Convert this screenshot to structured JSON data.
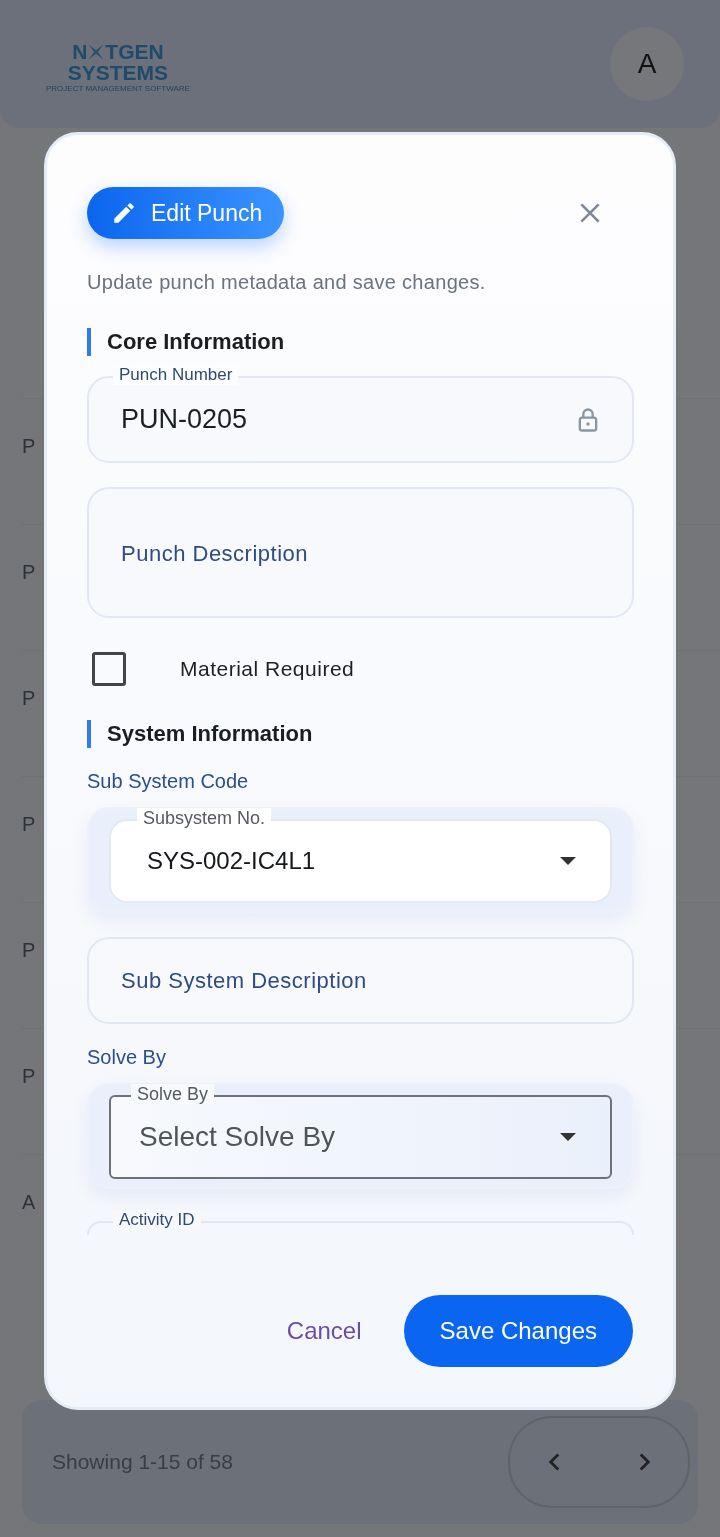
{
  "background": {
    "logo": {
      "lead": "N",
      "rest": "TGEN",
      "second": "SYSTEMS",
      "tagline": "PROJECT MANAGEMENT SOFTWARE"
    },
    "avatar": "A",
    "rows": [
      {
        "code": "P"
      },
      {
        "code": "P"
      },
      {
        "code": "P"
      },
      {
        "code": "P"
      },
      {
        "code": "P"
      },
      {
        "code": "P"
      },
      {
        "code": "A"
      }
    ],
    "footer": {
      "showing": "Showing 1-15 of 58"
    }
  },
  "dialog": {
    "badge": "Edit Punch",
    "subtitle": "Update punch metadata and save changes.",
    "sections": [
      {
        "title": "Core Information",
        "fields": [
          {
            "kind": "locked",
            "label": "Punch Number",
            "value": "PUN-0205"
          },
          {
            "kind": "textarea",
            "placeholder": "Punch Description"
          },
          {
            "kind": "checkbox",
            "label": "Material Required",
            "checked": false
          }
        ]
      },
      {
        "title": "System Information",
        "fields": [
          {
            "kind": "caption",
            "text": "Sub System Code"
          },
          {
            "kind": "select",
            "label": "Subsystem No.",
            "value": "SYS-002-IC4L1"
          },
          {
            "kind": "text",
            "placeholder": "Sub System Description"
          },
          {
            "kind": "caption",
            "text": "Solve By"
          },
          {
            "kind": "select",
            "label": "Solve By",
            "placeholder": "Select Solve By"
          },
          {
            "kind": "partial",
            "label": "Activity ID"
          }
        ]
      }
    ],
    "actions": [
      {
        "kind": "text",
        "label": "Cancel"
      },
      {
        "kind": "primary",
        "label": "Save Changes"
      }
    ]
  }
}
